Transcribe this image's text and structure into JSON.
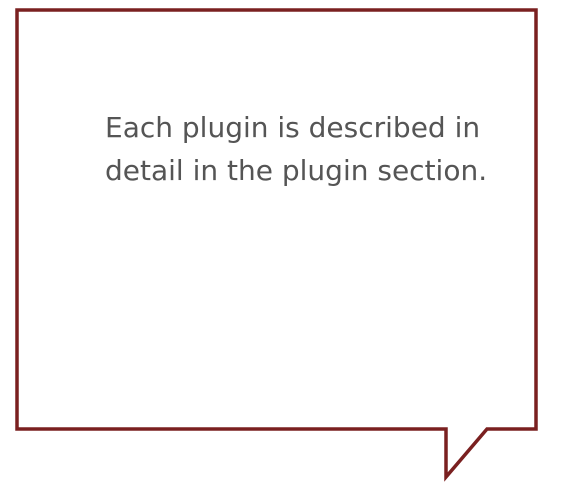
{
  "callout": {
    "text": "Each plugin is described in detail in the plugin section.",
    "border_color": "#7a2020",
    "text_color": "#555555",
    "background_color": "#ffffff"
  }
}
